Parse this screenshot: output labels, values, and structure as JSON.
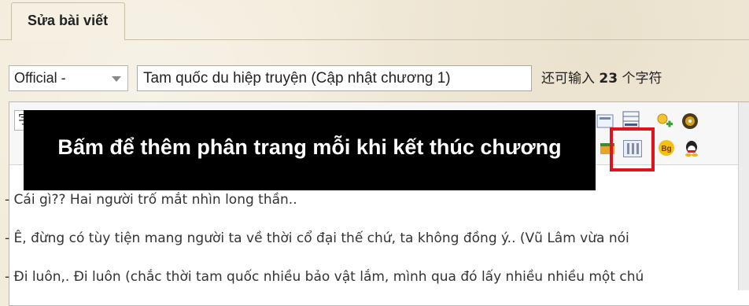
{
  "tab": {
    "label": "Sửa bài viết"
  },
  "form": {
    "category": {
      "selected": "Official -"
    },
    "title": {
      "value": "Tam quốc du hiệp truyện (Cập nhật chương 1)"
    },
    "counter": {
      "prefix": "还可输入",
      "count": "23",
      "suffix": "个字符"
    }
  },
  "toolbar": {
    "font_select": "字",
    "icons": [
      "image-icon",
      "table-icon",
      "add-user-icon",
      "media-disc-icon",
      "emoticon-icon",
      "page-break-icon",
      "bg-color-icon",
      "qq-icon"
    ]
  },
  "callout": {
    "text": "Bấm để thêm phân trang mỗi khi kết thúc chương"
  },
  "content": {
    "lines": [
      "- Cái gì?? Hai người trố mắt nhìn long thần..",
      "- Ê, đừng có tùy tiện mang người ta về thời cổ đại thế chứ, ta không đồng ý.. (Vũ Lâm vừa nói",
      "- Đi luôn,. Đi luôn (chắc thời tam quốc nhiều bảo vật lắm, mình qua đó lấy nhiều nhiều một chú"
    ]
  },
  "colors": {
    "highlight": "#e0121b",
    "callout_bg": "#000000",
    "callout_text": "#ffffff"
  }
}
